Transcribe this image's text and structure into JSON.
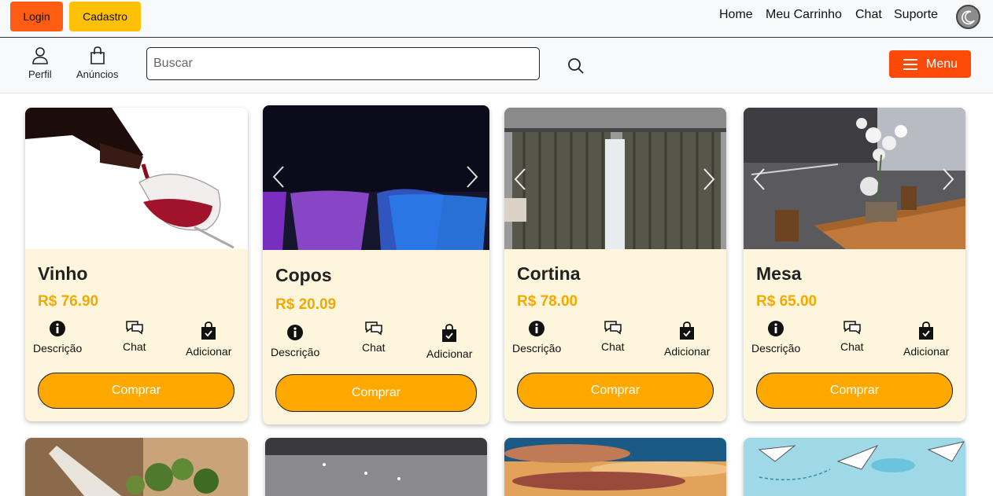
{
  "topbar": {
    "login_label": "Login",
    "cadastro_label": "Cadastro",
    "nav": [
      "Home",
      "Meu Carrinho",
      "Chat",
      "Suporte"
    ]
  },
  "subbar": {
    "perfil_label": "Perfil",
    "anuncios_label": "Anúncios",
    "search_placeholder": "Buscar",
    "menu_label": "Menu"
  },
  "colors": {
    "login_bg": "#fd5c12",
    "cadastro_bg": "#ffc107",
    "menu_bg": "#fd4a08",
    "price": "#f5a800",
    "buy_bg": "#ffa800",
    "card_bg": "#fef6dc"
  },
  "products": [
    {
      "title": "Vinho",
      "price": "R$ 76.90",
      "desc_label": "Descrição",
      "chat_label": "Chat",
      "add_label": "Adicionar",
      "buy_label": "Comprar"
    },
    {
      "title": "Copos",
      "price": "R$ 20.09",
      "desc_label": "Descrição",
      "chat_label": "Chat",
      "add_label": "Adicionar",
      "buy_label": "Comprar"
    },
    {
      "title": "Cortina",
      "price": "R$ 78.00",
      "desc_label": "Descrição",
      "chat_label": "Chat",
      "add_label": "Adicionar",
      "buy_label": "Comprar"
    },
    {
      "title": "Mesa",
      "price": "R$ 65.00",
      "desc_label": "Descrição",
      "chat_label": "Chat",
      "add_label": "Adicionar",
      "buy_label": "Comprar"
    }
  ],
  "icons": {
    "theme": "moon-icon",
    "perfil": "user-icon",
    "anuncios": "shopping-bag-icon",
    "search": "search-icon",
    "menu": "hamburger-icon",
    "desc": "info-icon",
    "chat": "chat-bubbles-icon",
    "add": "bag-check-icon",
    "prev": "chevron-left-icon",
    "next": "chevron-right-icon"
  }
}
